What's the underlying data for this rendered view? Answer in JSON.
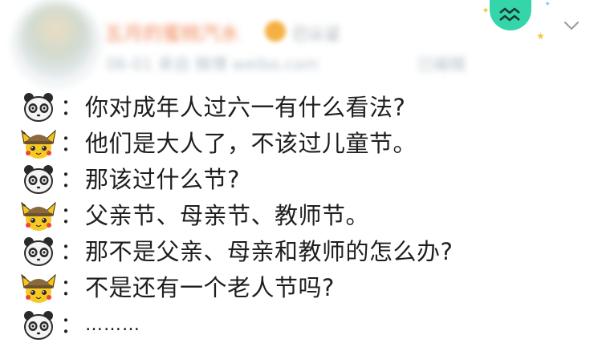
{
  "header": {
    "username": "五月的蜜桃汽水",
    "tag": "已认证",
    "meta": "06-01 来自 微博 weibo.com",
    "meta2": "已编辑",
    "zodiac_symbol": "≈"
  },
  "conversation": [
    {
      "speaker": "panda",
      "text": "你对成年人过六一有什么看法?"
    },
    {
      "speaker": "pikachu",
      "text": "他们是大人了，不该过儿童节。"
    },
    {
      "speaker": "panda",
      "text": "那该过什么节?"
    },
    {
      "speaker": "pikachu",
      "text": "父亲节、母亲节、教师节。"
    },
    {
      "speaker": "panda",
      "text": "那不是父亲、母亲和教师的怎么办?"
    },
    {
      "speaker": "pikachu",
      "text": "不是还有一个老人节吗?"
    },
    {
      "speaker": "panda",
      "text": "………"
    }
  ],
  "separator": "：",
  "colors": {
    "zodiac_badge": "#34d6a9",
    "username": "#f08a5d",
    "text": "#1e1e1e"
  },
  "icons": [
    "panda-face-icon",
    "detective-pikachu-icon",
    "aquarius-zodiac-icon",
    "chevron-down-icon",
    "sparkle-icon"
  ]
}
